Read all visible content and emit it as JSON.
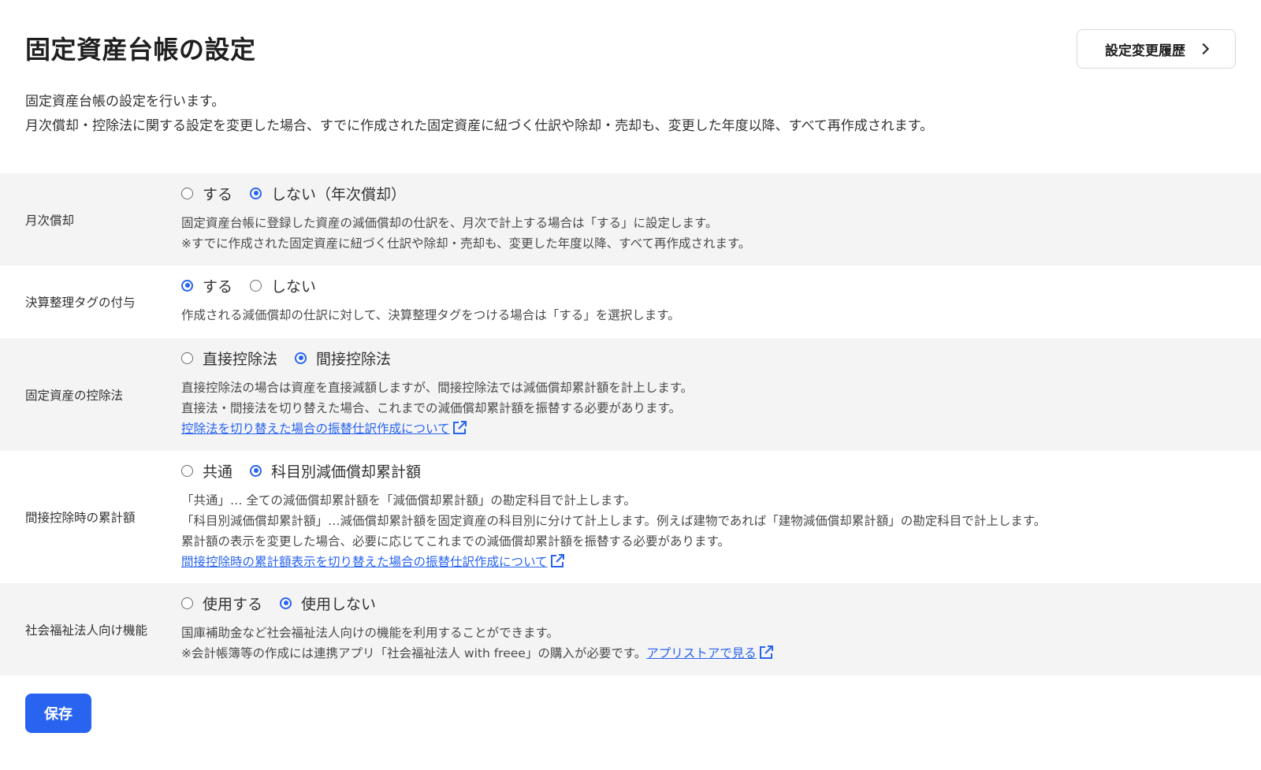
{
  "page": {
    "title": "固定資産台帳の設定",
    "history_button": "設定変更履歴",
    "intro": [
      "固定資産台帳の設定を行います。",
      "月次償却・控除法に関する設定を変更した場合、すでに作成された固定資産に紐づく仕訳や除却・売却も、変更した年度以降、すべて再作成されます。"
    ]
  },
  "settings": {
    "monthly": {
      "label": "月次償却",
      "options": [
        "する",
        "しない（年次償却）"
      ],
      "selected": "しない（年次償却）",
      "desc": [
        "固定資産台帳に登録した資産の減価償却の仕訳を、月次で計上する場合は「する」に設定します。",
        "※すでに作成された固定資産に紐づく仕訳や除却・売却も、変更した年度以降、すべて再作成されます。"
      ]
    },
    "tag": {
      "label": "決算整理タグの付与",
      "options": [
        "する",
        "しない"
      ],
      "selected": "する",
      "desc": [
        "作成される減価償却の仕訳に対して、決算整理タグをつける場合は「する」を選択します。"
      ]
    },
    "deduction": {
      "label": "固定資産の控除法",
      "options": [
        "直接控除法",
        "間接控除法"
      ],
      "selected": "間接控除法",
      "desc": [
        "直接控除法の場合は資産を直接減額しますが、間接控除法では減価償却累計額を計上します。",
        "直接法・間接法を切り替えた場合、これまでの減価償却累計額を振替する必要があります。"
      ],
      "link": "控除法を切り替えた場合の振替仕訳作成について"
    },
    "accum": {
      "label": "間接控除時の累計額",
      "options": [
        "共通",
        "科目別減価償却累計額"
      ],
      "selected": "科目別減価償却累計額",
      "desc": [
        "「共通」… 全ての減価償却累計額を「減価償却累計額」の勘定科目で計上します。",
        "「科目別減価償却累計額」…減価償却累計額を固定資産の科目別に分けて計上します。例えば建物であれば「建物減価償却累計額」の勘定科目で計上します。",
        "累計額の表示を変更した場合、必要に応じてこれまでの減価償却累計額を振替する必要があります。"
      ],
      "link": "間接控除時の累計額表示を切り替えた場合の振替仕訳作成について"
    },
    "welfare": {
      "label": "社会福祉法人向け機能",
      "options": [
        "使用する",
        "使用しない"
      ],
      "selected": "使用しない",
      "desc": [
        "国庫補助金など社会福祉法人向けの機能を利用することができます。"
      ],
      "note": "※会計帳簿等の作成には連携アプリ「社会福祉法人 with freee」の購入が必要です。",
      "link": "アプリストアで見る"
    }
  },
  "save_button": "保存",
  "colors": {
    "accent": "#2864f0",
    "row_gray": "#f5f4f4"
  }
}
